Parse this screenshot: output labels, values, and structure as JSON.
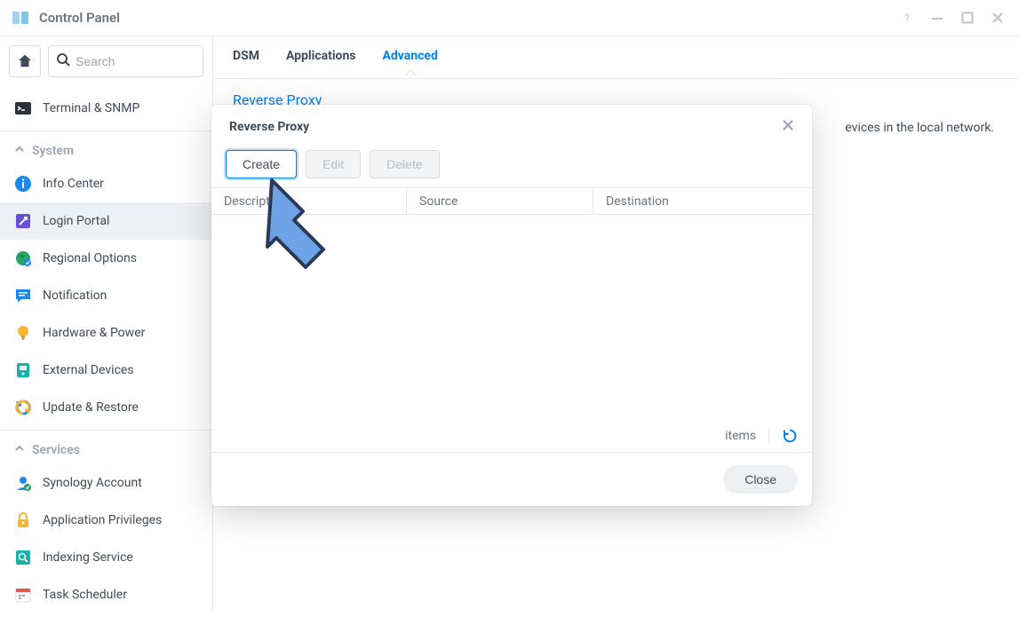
{
  "window": {
    "title": "Control Panel"
  },
  "search": {
    "placeholder": "Search"
  },
  "sidebar": {
    "top_item": "Terminal & SNMP",
    "groups": [
      {
        "label": "System",
        "items": [
          {
            "label": "Info Center",
            "icon": "info",
            "active": false
          },
          {
            "label": "Login Portal",
            "icon": "portal",
            "active": true
          },
          {
            "label": "Regional Options",
            "icon": "globe",
            "active": false
          },
          {
            "label": "Notification",
            "icon": "chat",
            "active": false
          },
          {
            "label": "Hardware & Power",
            "icon": "bulb",
            "active": false
          },
          {
            "label": "External Devices",
            "icon": "device",
            "active": false
          },
          {
            "label": "Update & Restore",
            "icon": "update",
            "active": false
          }
        ]
      },
      {
        "label": "Services",
        "items": [
          {
            "label": "Synology Account",
            "icon": "account",
            "active": false
          },
          {
            "label": "Application Privileges",
            "icon": "lock",
            "active": false
          },
          {
            "label": "Indexing Service",
            "icon": "index",
            "active": false
          },
          {
            "label": "Task Scheduler",
            "icon": "calendar",
            "active": false
          }
        ]
      }
    ]
  },
  "tabs": [
    {
      "label": "DSM",
      "active": false
    },
    {
      "label": "Applications",
      "active": false
    },
    {
      "label": "Advanced",
      "active": true
    }
  ],
  "breadcrumb": "Reverse Proxy",
  "help_text_tail": "evices in the local network.",
  "modal": {
    "title": "Reverse Proxy",
    "buttons": {
      "create": "Create",
      "edit": "Edit",
      "delete": "Delete",
      "close": "Close"
    },
    "columns": [
      "Description",
      "Source",
      "Destination"
    ],
    "rows": [],
    "footer_label": "items"
  }
}
